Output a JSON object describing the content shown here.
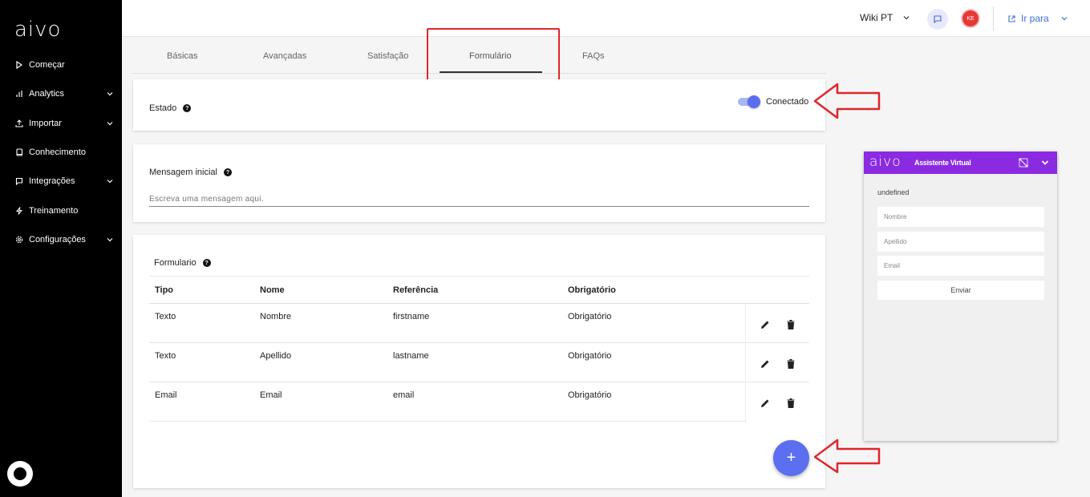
{
  "sidebar": {
    "logo": "aivo",
    "items": [
      {
        "label": "Começar",
        "icon": "play-icon",
        "expandable": false
      },
      {
        "label": "Analytics",
        "icon": "bar-chart-icon",
        "expandable": true
      },
      {
        "label": "Importar",
        "icon": "upload-icon",
        "expandable": true
      },
      {
        "label": "Conhecimento",
        "icon": "book-icon",
        "expandable": false
      },
      {
        "label": "Integrações",
        "icon": "chat-bubble-icon",
        "expandable": true
      },
      {
        "label": "Treinamento",
        "icon": "bolt-icon",
        "expandable": false
      },
      {
        "label": "Configurações",
        "icon": "gear-icon",
        "expandable": true
      }
    ]
  },
  "topbar": {
    "bot_selector": "Wiki PT",
    "avatar_initials": "KE",
    "goto_label": "Ir para"
  },
  "tabs": [
    {
      "label": "Básicas"
    },
    {
      "label": "Avançadas"
    },
    {
      "label": "Satisfação"
    },
    {
      "label": "Formulário"
    },
    {
      "label": "FAQs"
    }
  ],
  "active_tab": "Formulário",
  "estado": {
    "label": "Estado",
    "toggle_on": true,
    "toggle_label": "Conectado"
  },
  "mensagem": {
    "label": "Mensagem inicial",
    "placeholder": "Escreva uma mensagem aqui."
  },
  "formulario": {
    "label": "Formulario",
    "headers": {
      "tipo": "Tipo",
      "nome": "Nome",
      "referencia": "Referência",
      "obrigatorio": "Obrigatório"
    },
    "rows": [
      {
        "tipo": "Texto",
        "nome": "Nombre",
        "referencia": "firstname",
        "obrigatorio": "Obrigatório"
      },
      {
        "tipo": "Texto",
        "nome": "Apellido",
        "referencia": "lastname",
        "obrigatorio": "Obrigatório"
      },
      {
        "tipo": "Email",
        "nome": "Email",
        "referencia": "email",
        "obrigatorio": "Obrigatório"
      }
    ],
    "add_button": "+"
  },
  "widget": {
    "logo": "aivo",
    "title": "Assistente Virtual",
    "message": "undefined",
    "fields": [
      "Nombre",
      "Apellido",
      "Email"
    ],
    "send_label": "Enviar"
  },
  "colors": {
    "accent": "#5b6ff0",
    "widget_header": "#8a2be2",
    "annotation_red": "#e0262b",
    "sidebar_bg": "#000000"
  }
}
